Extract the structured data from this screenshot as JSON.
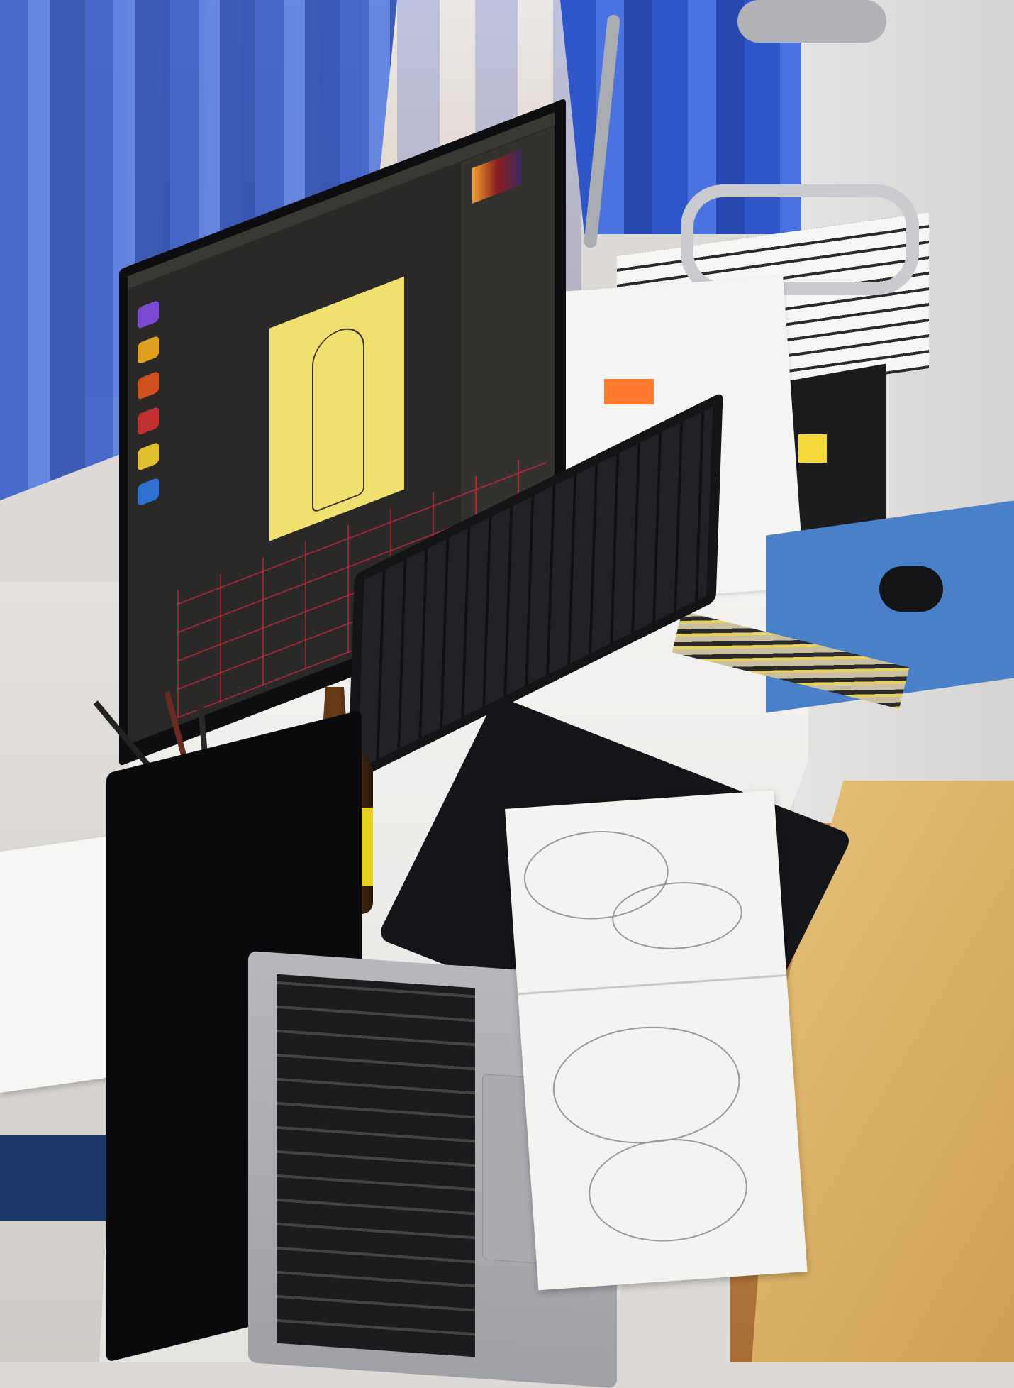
{
  "scene": {
    "description_label": "",
    "objects": [
      "window",
      "curtains",
      "desk",
      "monitor",
      "keyboard",
      "laptop",
      "drawing-tablet",
      "sketchbook",
      "bottle",
      "pencil-cup",
      "headphones",
      "desk-lamp",
      "chair"
    ]
  },
  "colors": {
    "curtain": "#3b5fc6",
    "monitor_canvas": "#f0e070",
    "bottle_label": "#e8d020",
    "sticky_orange": "#ff7a2e",
    "sticky_yellow": "#f4d83c"
  }
}
